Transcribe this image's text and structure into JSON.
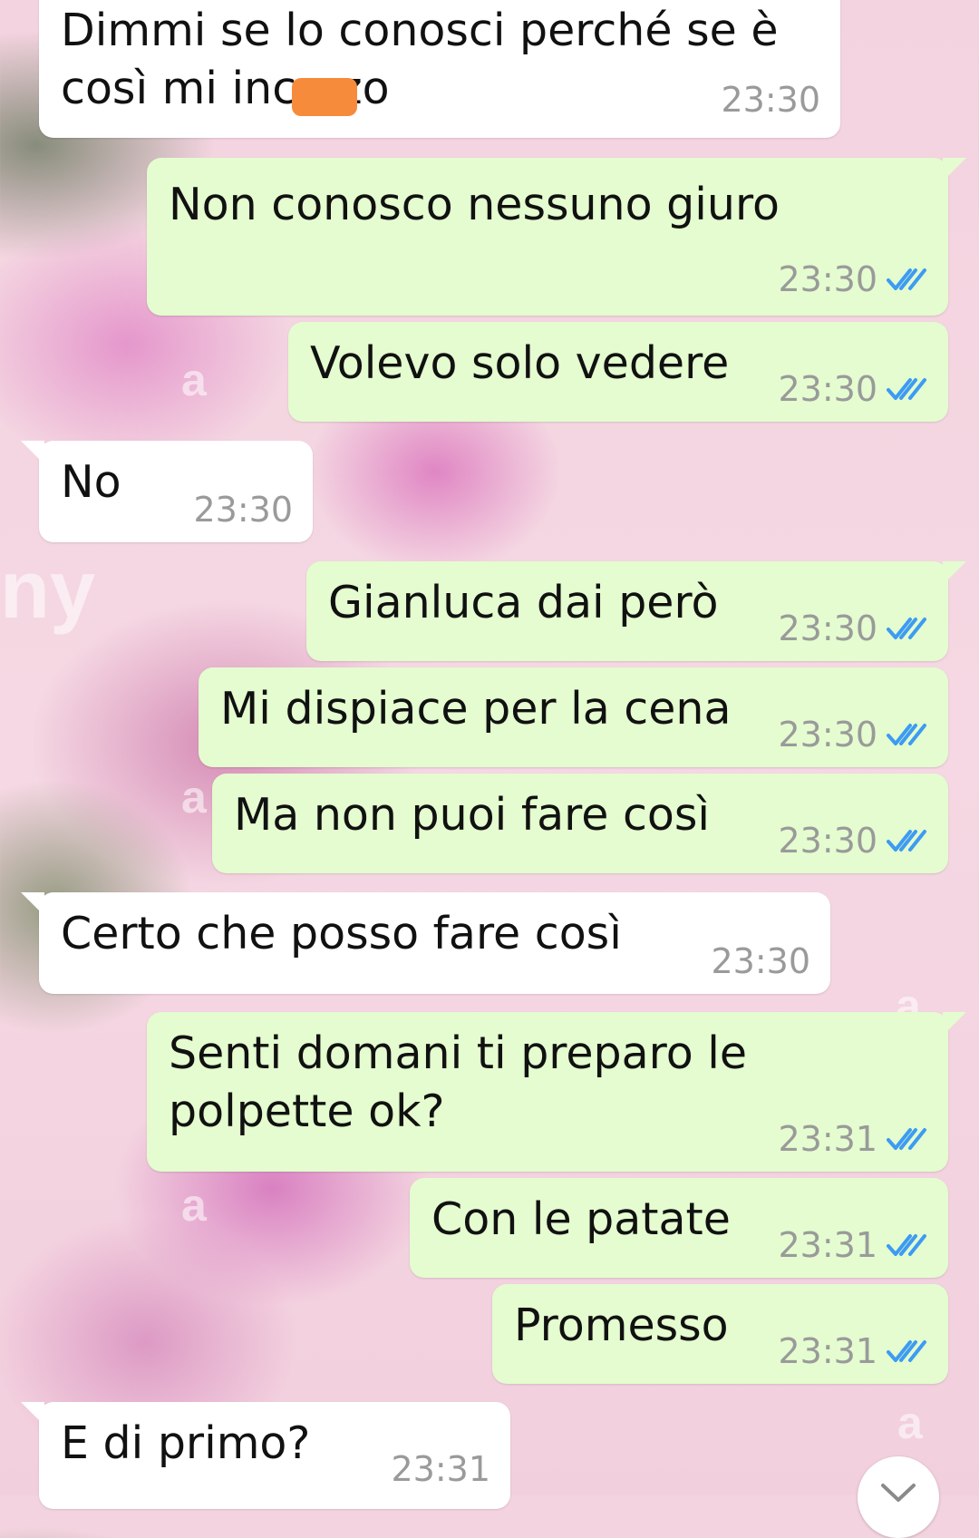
{
  "colors": {
    "incoming_bubble": "#ffffff",
    "outgoing_bubble": "#e4fccf",
    "read_tick": "#3d9bf2",
    "time_text": "#9a9a9a",
    "redaction": "#f68b3c"
  },
  "messages": [
    {
      "direction": "in",
      "text": "Dimmi se lo conosci perché se è\ncosì mi inc   zo",
      "time": "23:30"
    },
    {
      "direction": "out",
      "text": "Non conosco nessuno giuro",
      "time": "23:30",
      "status": "read"
    },
    {
      "direction": "out",
      "text": "Volevo solo vedere",
      "time": "23:30",
      "status": "read"
    },
    {
      "direction": "in",
      "text": "No",
      "time": "23:30"
    },
    {
      "direction": "out",
      "text": "Gianluca dai però",
      "time": "23:30",
      "status": "read"
    },
    {
      "direction": "out",
      "text": "Mi dispiace per la cena",
      "time": "23:30",
      "status": "read"
    },
    {
      "direction": "out",
      "text": "Ma non puoi fare così",
      "time": "23:30",
      "status": "read"
    },
    {
      "direction": "in",
      "text": "Certo che posso fare così",
      "time": "23:30"
    },
    {
      "direction": "out",
      "text": "Senti domani ti preparo le\npolpette ok?",
      "time": "23:31",
      "status": "read"
    },
    {
      "direction": "out",
      "text": "Con le patate",
      "time": "23:31",
      "status": "read"
    },
    {
      "direction": "out",
      "text": "Promesso",
      "time": "23:31",
      "status": "read"
    },
    {
      "direction": "in",
      "text": "E di primo?",
      "time": "23:31"
    }
  ],
  "icons": {
    "read_receipt": "double-check-icon",
    "scroll_down": "chevron-down-icon"
  }
}
